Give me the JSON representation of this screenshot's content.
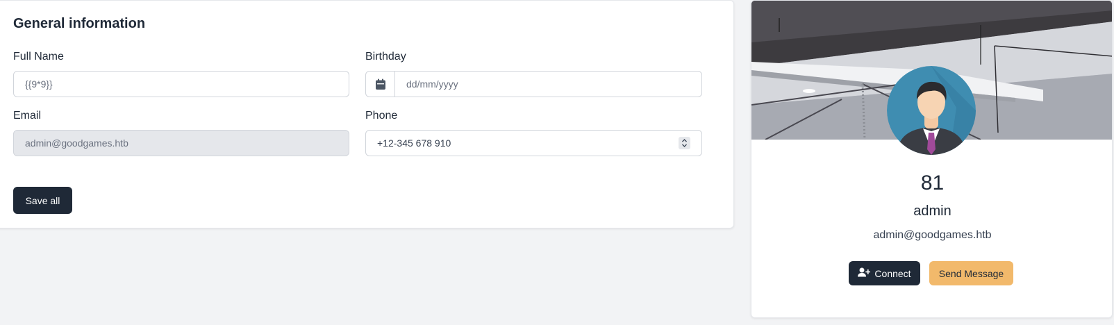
{
  "general": {
    "title": "General information",
    "full_name": {
      "label": "Full Name",
      "value": "{{9*9}}"
    },
    "birthday": {
      "label": "Birthday",
      "placeholder": "dd/mm/yyyy"
    },
    "email": {
      "label": "Email",
      "value": "admin@goodgames.htb"
    },
    "phone": {
      "label": "Phone",
      "value": "+12-345 678 910"
    },
    "save_label": "Save all"
  },
  "profile": {
    "number": "81",
    "name": "admin",
    "email": "admin@goodgames.htb",
    "connect_label": "Connect",
    "message_label": "Send Message"
  },
  "colors": {
    "primary": "#1f2937",
    "accent": "#f2b96b",
    "background": "#f2f3f5"
  },
  "icons": [
    "calendar-icon",
    "stepper-icon",
    "user-plus-icon",
    "avatar-illustration"
  ]
}
